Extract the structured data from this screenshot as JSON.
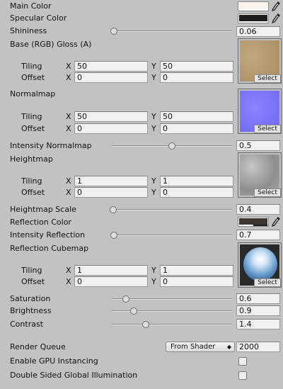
{
  "material": {
    "main_color": {
      "label": "Main Color",
      "color": "#fdf3f1"
    },
    "specular_color": {
      "label": "Specular Color",
      "color": "#201c1a"
    },
    "shininess": {
      "label": "Shininess",
      "value": "0.06",
      "fraction": 0.02
    },
    "base_texture": {
      "label": "Base (RGB) Gloss (A)",
      "tiling": {
        "label": "Tiling",
        "x": "50",
        "y": "50"
      },
      "offset": {
        "label": "Offset",
        "x": "0",
        "y": "0"
      },
      "select_label": "Select",
      "preview_color": "#b69a72"
    },
    "normalmap": {
      "label": "Normalmap",
      "tiling": {
        "label": "Tiling",
        "x": "50",
        "y": "50"
      },
      "offset": {
        "label": "Offset",
        "x": "0",
        "y": "0"
      },
      "select_label": "Select",
      "preview_color": "#7a74f6"
    },
    "intensity_normalmap": {
      "label": "Intensity Normalmap",
      "value": "0.5",
      "fraction": 0.5
    },
    "heightmap": {
      "label": "Heightmap",
      "tiling": {
        "label": "Tiling",
        "x": "1",
        "y": "1"
      },
      "offset": {
        "label": "Offset",
        "x": "0",
        "y": "0"
      },
      "select_label": "Select",
      "preview_color": "#9a9a9a"
    },
    "heightmap_scale": {
      "label": "Heightmap Scale",
      "value": "0.4",
      "fraction": 0.0
    },
    "reflection_color": {
      "label": "Reflection Color",
      "color": "#3f3530"
    },
    "intensity_reflection": {
      "label": "Intensity Reflection",
      "value": "0.7",
      "fraction": 0.0
    },
    "reflection_cubemap": {
      "label": "Reflection Cubemap",
      "tiling": {
        "label": "Tiling",
        "x": "1",
        "y": "1"
      },
      "offset": {
        "label": "Offset",
        "x": "0",
        "y": "0"
      },
      "select_label": "Select",
      "preview_color": "#4a7eb2"
    },
    "saturation": {
      "label": "Saturation",
      "value": "0.6",
      "fraction": 0.12
    },
    "brightness": {
      "label": "Brightness",
      "value": "0.9",
      "fraction": 0.18
    },
    "contrast": {
      "label": "Contrast",
      "value": "1.4",
      "fraction": 0.28
    },
    "render_queue": {
      "label": "Render Queue",
      "mode": "From Shader",
      "value": "2000"
    },
    "gpu_instancing": {
      "label": "Enable GPU Instancing",
      "checked": false
    },
    "double_sided_gi": {
      "label": "Double Sided Global Illumination",
      "checked": false
    },
    "axis_x": "X",
    "axis_y": "Y"
  }
}
